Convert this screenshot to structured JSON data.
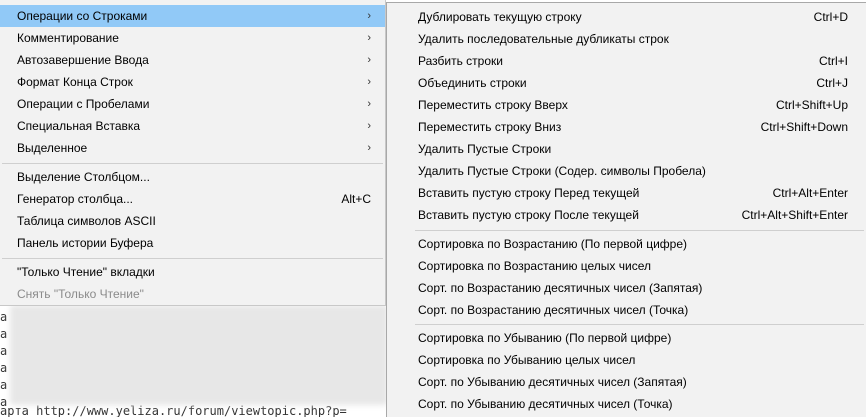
{
  "editor": {
    "lines": [
      "a",
      "a",
      "a",
      "a",
      "a",
      "a",
      "арта http://www.yeliza.ru/forum/viewtopic.php?p="
    ]
  },
  "left_menu": {
    "items": [
      {
        "label": "Операции со Строками",
        "shortcut": "",
        "submenu": true,
        "active": true,
        "disabled": false
      },
      {
        "label": "Комментирование",
        "shortcut": "",
        "submenu": true,
        "active": false,
        "disabled": false
      },
      {
        "label": "Автозавершение Ввода",
        "shortcut": "",
        "submenu": true,
        "active": false,
        "disabled": false
      },
      {
        "label": "Формат Конца Строк",
        "shortcut": "",
        "submenu": true,
        "active": false,
        "disabled": false
      },
      {
        "label": "Операции с Пробелами",
        "shortcut": "",
        "submenu": true,
        "active": false,
        "disabled": false
      },
      {
        "label": "Специальная Вставка",
        "shortcut": "",
        "submenu": true,
        "active": false,
        "disabled": false
      },
      {
        "label": "Выделенное",
        "shortcut": "",
        "submenu": true,
        "active": false,
        "disabled": false
      },
      {
        "label": "Выделение Столбцом...",
        "shortcut": "",
        "submenu": false,
        "active": false,
        "disabled": false
      },
      {
        "label": "Генератор столбца...",
        "shortcut": "Alt+C",
        "submenu": false,
        "active": false,
        "disabled": false
      },
      {
        "label": "Таблица символов ASCII",
        "shortcut": "",
        "submenu": false,
        "active": false,
        "disabled": false
      },
      {
        "label": "Панель истории Буфера",
        "shortcut": "",
        "submenu": false,
        "active": false,
        "disabled": false
      },
      {
        "label": "\"Только Чтение\" вкладки",
        "shortcut": "",
        "submenu": false,
        "active": false,
        "disabled": false
      },
      {
        "label": "Снять \"Только Чтение\"",
        "shortcut": "",
        "submenu": false,
        "active": false,
        "disabled": true
      }
    ]
  },
  "right_menu": {
    "items": [
      {
        "label": "Дублировать текущую строку",
        "shortcut": "Ctrl+D"
      },
      {
        "label": "Удалить последовательные дубликаты строк",
        "shortcut": ""
      },
      {
        "label": "Разбить строки",
        "shortcut": "Ctrl+I"
      },
      {
        "label": "Объединить строки",
        "shortcut": "Ctrl+J"
      },
      {
        "label": "Переместить строку Вверх",
        "shortcut": "Ctrl+Shift+Up"
      },
      {
        "label": "Переместить строку Вниз",
        "shortcut": "Ctrl+Shift+Down"
      },
      {
        "label": "Удалить Пустые Строки",
        "shortcut": ""
      },
      {
        "label": "Удалить Пустые Строки (Содер. символы Пробела)",
        "shortcut": ""
      },
      {
        "label": "Вставить пустую строку Перед текущей",
        "shortcut": "Ctrl+Alt+Enter"
      },
      {
        "label": "Вставить пустую строку После текущей",
        "shortcut": "Ctrl+Alt+Shift+Enter"
      },
      {
        "label": "Сортировка по Возрастанию (По первой цифре)",
        "shortcut": ""
      },
      {
        "label": "Сортировка по Возрастанию целых чисел",
        "shortcut": ""
      },
      {
        "label": "Сорт. по Возрастанию десятичных чисел (Запятая)",
        "shortcut": ""
      },
      {
        "label": "Сорт. по Возрастанию десятичных чисел (Точка)",
        "shortcut": ""
      },
      {
        "label": "Сортировка по Убыванию (По первой цифре)",
        "shortcut": ""
      },
      {
        "label": "Сортировка по Убыванию целых чисел",
        "shortcut": ""
      },
      {
        "label": "Сорт. по Убыванию десятичных чисел (Запятая)",
        "shortcut": ""
      },
      {
        "label": "Сорт. по Убыванию десятичных чисел (Точка)",
        "shortcut": ""
      }
    ]
  },
  "icons": {
    "submenu_arrow": "chevron-right-icon"
  }
}
